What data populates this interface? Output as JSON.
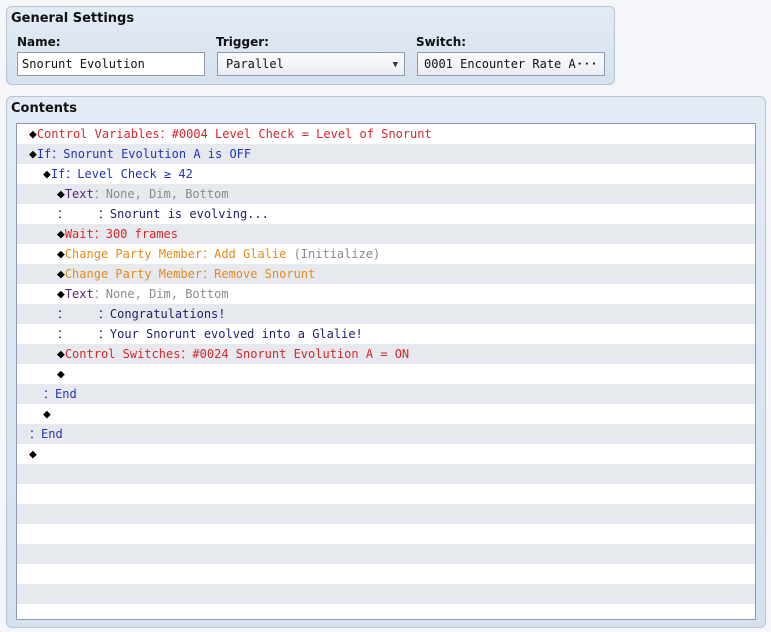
{
  "general_settings": {
    "title": "General Settings",
    "name_label": "Name:",
    "name_value": "Snorunt Evolution",
    "trigger_label": "Trigger:",
    "trigger_value": "Parallel",
    "switch_label": "Switch:",
    "switch_value": "0001 Encounter Rate A···",
    "switch_more": "···"
  },
  "contents": {
    "title": "Contents",
    "lines": [
      {
        "indent": 0,
        "diamond": true,
        "segments": [
          {
            "text": "Control Variables：#0004 Level Check = Level of Snorunt",
            "color": "red"
          }
        ]
      },
      {
        "indent": 0,
        "diamond": true,
        "segments": [
          {
            "text": "If：Snorunt Evolution A is OFF",
            "color": "blue"
          }
        ]
      },
      {
        "indent": 1,
        "diamond": true,
        "segments": [
          {
            "text": "If：Level Check ≥ 42",
            "color": "blue"
          }
        ]
      },
      {
        "indent": 2,
        "diamond": true,
        "segments": [
          {
            "text": "Text",
            "color": "purple"
          },
          {
            "text": "：None, Dim, Bottom",
            "color": "gray"
          }
        ]
      },
      {
        "indent": 2,
        "diamond": false,
        "segments": [
          {
            "text": "：    ：",
            "color": "navy"
          },
          {
            "text": "Snorunt is evolving...",
            "color": "navy"
          }
        ]
      },
      {
        "indent": 2,
        "diamond": true,
        "segments": [
          {
            "text": "Wait：300 frames",
            "color": "red"
          }
        ]
      },
      {
        "indent": 2,
        "diamond": true,
        "segments": [
          {
            "text": "Change Party Member：Add Glalie",
            "color": "orange"
          },
          {
            "text": " (Initialize)",
            "color": "gray"
          }
        ]
      },
      {
        "indent": 2,
        "diamond": true,
        "segments": [
          {
            "text": "Change Party Member：Remove Snorunt",
            "color": "orange"
          }
        ]
      },
      {
        "indent": 2,
        "diamond": true,
        "segments": [
          {
            "text": "Text",
            "color": "purple"
          },
          {
            "text": "：None, Dim, Bottom",
            "color": "gray"
          }
        ]
      },
      {
        "indent": 2,
        "diamond": false,
        "segments": [
          {
            "text": "：    ：",
            "color": "navy"
          },
          {
            "text": "Congratulations!",
            "color": "navy"
          }
        ]
      },
      {
        "indent": 2,
        "diamond": false,
        "segments": [
          {
            "text": "：    ：",
            "color": "navy"
          },
          {
            "text": "Your Snorunt evolved into a Glalie!",
            "color": "navy"
          }
        ]
      },
      {
        "indent": 2,
        "diamond": true,
        "segments": [
          {
            "text": "Control Switches：#0024 Snorunt Evolution A = ON",
            "color": "red"
          }
        ]
      },
      {
        "indent": 2,
        "diamond": true,
        "segments": []
      },
      {
        "indent": 1,
        "diamond": false,
        "segments": [
          {
            "text": "：End",
            "color": "blue"
          }
        ]
      },
      {
        "indent": 1,
        "diamond": true,
        "segments": []
      },
      {
        "indent": 0,
        "diamond": false,
        "segments": [
          {
            "text": "：End",
            "color": "blue"
          }
        ]
      },
      {
        "indent": 0,
        "diamond": true,
        "segments": []
      }
    ],
    "empty_rows": 8
  },
  "colors": {
    "red": "#d8262a",
    "blue": "#2233b8",
    "purple": "#5a1f7c",
    "orange": "#e58a1c",
    "gray": "#8a8a8a",
    "navy": "#1b1f6b"
  }
}
